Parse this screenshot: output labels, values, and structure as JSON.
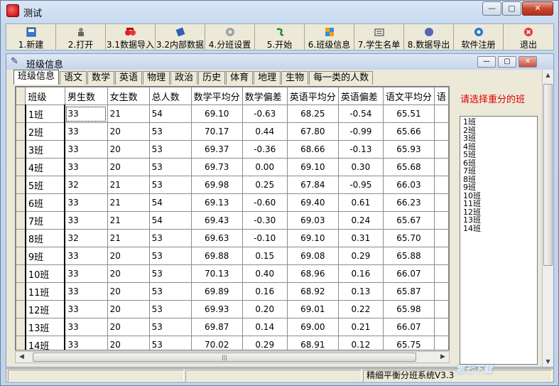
{
  "window": {
    "title": "测试",
    "controls": {
      "minimize": "—",
      "maximize": "▢",
      "close": "✕"
    }
  },
  "toolbar": {
    "buttons": [
      {
        "label": "1.新建",
        "icon": "new-icon"
      },
      {
        "label": "2.打开",
        "icon": "open-icon"
      },
      {
        "label": "3.1数据导入",
        "icon": "import-icon"
      },
      {
        "label": "3.2内部数据",
        "icon": "internal-data-icon"
      },
      {
        "label": "4.分班设置",
        "icon": "gear-icon"
      },
      {
        "label": "5.开始",
        "icon": "start-icon"
      },
      {
        "label": "6.班级信息",
        "icon": "class-info-icon"
      },
      {
        "label": "7.学生名单",
        "icon": "student-list-icon"
      },
      {
        "label": "8.数据导出",
        "icon": "export-icon"
      },
      {
        "label": "软件注册",
        "icon": "register-icon"
      },
      {
        "label": "退出",
        "icon": "exit-icon"
      }
    ]
  },
  "child_window": {
    "title": "班级信息",
    "tabs": [
      "班级信息",
      "语文",
      "数学",
      "英语",
      "物理",
      "政治",
      "历史",
      "体育",
      "地理",
      "生物",
      "每一类的人数"
    ],
    "active_tab": "班级信息"
  },
  "grid": {
    "columns": [
      "班级",
      "男生数",
      "女生数",
      "总人数",
      "数学平均分",
      "数学偏差",
      "英语平均分",
      "英语偏差",
      "语文平均分",
      "语"
    ],
    "rows": [
      [
        "1班",
        "33",
        "21",
        "54",
        "69.10",
        "-0.63",
        "68.25",
        "-0.54",
        "65.51"
      ],
      [
        "2班",
        "33",
        "20",
        "53",
        "70.17",
        "0.44",
        "67.80",
        "-0.99",
        "65.66"
      ],
      [
        "3班",
        "33",
        "20",
        "53",
        "69.37",
        "-0.36",
        "68.66",
        "-0.13",
        "65.93"
      ],
      [
        "4班",
        "33",
        "20",
        "53",
        "69.73",
        "0.00",
        "69.10",
        "0.30",
        "65.68"
      ],
      [
        "5班",
        "32",
        "21",
        "53",
        "69.98",
        "0.25",
        "67.84",
        "-0.95",
        "66.03"
      ],
      [
        "6班",
        "33",
        "21",
        "54",
        "69.13",
        "-0.60",
        "69.40",
        "0.61",
        "66.23"
      ],
      [
        "7班",
        "33",
        "21",
        "54",
        "69.43",
        "-0.30",
        "69.03",
        "0.24",
        "65.67"
      ],
      [
        "8班",
        "32",
        "21",
        "53",
        "69.63",
        "-0.10",
        "69.10",
        "0.31",
        "65.70"
      ],
      [
        "9班",
        "33",
        "20",
        "53",
        "69.88",
        "0.15",
        "69.08",
        "0.29",
        "65.88"
      ],
      [
        "10班",
        "33",
        "20",
        "53",
        "70.13",
        "0.40",
        "68.96",
        "0.16",
        "66.07"
      ],
      [
        "11班",
        "33",
        "20",
        "53",
        "69.89",
        "0.16",
        "68.92",
        "0.13",
        "65.87"
      ],
      [
        "12班",
        "33",
        "20",
        "53",
        "69.93",
        "0.20",
        "69.01",
        "0.22",
        "65.98"
      ],
      [
        "13班",
        "33",
        "20",
        "53",
        "69.87",
        "0.14",
        "69.00",
        "0.21",
        "66.07"
      ],
      [
        "14班",
        "33",
        "20",
        "53",
        "70.02",
        "0.29",
        "68.91",
        "0.12",
        "65.75"
      ]
    ]
  },
  "side_panel": {
    "prompt": "请选择重分的班",
    "classes": [
      "1班",
      "2班",
      "3班",
      "4班",
      "5班",
      "6班",
      "7班",
      "8班",
      "9班",
      "10班",
      "11班",
      "12班",
      "13班",
      "14班"
    ]
  },
  "scrollbars": {
    "left_arrow": "◀",
    "right_arrow": "▶",
    "up_arrow": "▲",
    "down_arrow": "▼",
    "grip": "|||"
  },
  "statusbar": {
    "product": "精细平衡分班系统V3.3"
  },
  "watermark": "第七下载"
}
